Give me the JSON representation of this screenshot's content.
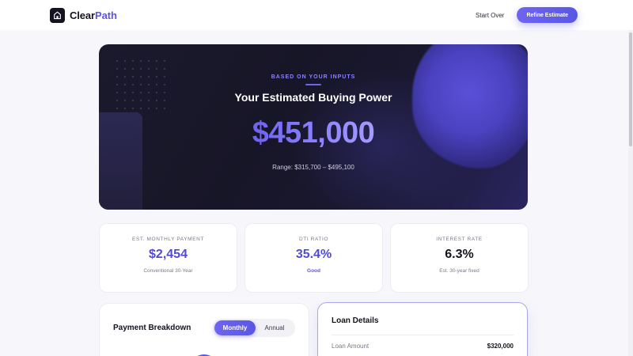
{
  "header": {
    "brand_part1": "Clear",
    "brand_part2": "Path",
    "start_over_label": "Start Over",
    "refine_label": "Refine Estimate"
  },
  "hero": {
    "eyebrow": "BASED ON YOUR INPUTS",
    "title": "Your Estimated Buying Power",
    "amount": "$451,000",
    "range": "Range: $315,700 – $495,100"
  },
  "stats": [
    {
      "label": "EST. MONTHLY PAYMENT",
      "value": "$2,454",
      "sub": "Conventional 30-Year"
    },
    {
      "label": "DTI RATIO",
      "value": "35.4%",
      "sub": "Good"
    },
    {
      "label": "INTEREST RATE",
      "value": "6.3%",
      "sub": "Est. 30-year fixed"
    }
  ],
  "breakdown": {
    "title": "Payment Breakdown",
    "toggle_monthly": "Monthly",
    "toggle_annual": "Annual"
  },
  "loan": {
    "title": "Loan Details",
    "rows": [
      {
        "label": "Loan Amount",
        "value": "$320,000"
      }
    ]
  },
  "colors": {
    "accent": "#5b57e6",
    "hero_bg": "#1b1a2d",
    "page_bg": "#f7f7fb"
  }
}
